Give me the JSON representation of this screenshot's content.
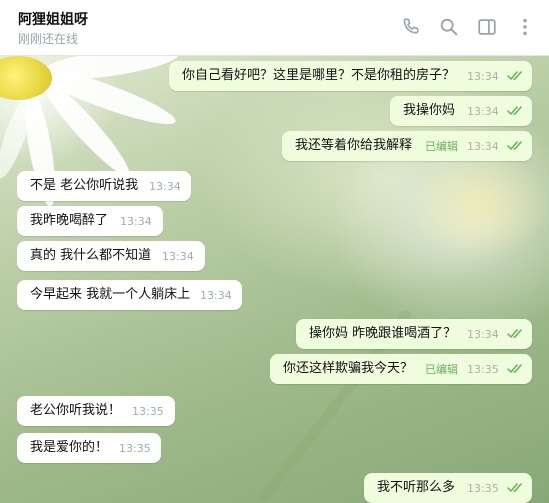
{
  "header": {
    "title": "阿狸姐姐呀",
    "status": "刚刚还在线",
    "icons": [
      "phone-icon",
      "search-icon",
      "sidebar-icon",
      "more-icon"
    ]
  },
  "theme": {
    "outgoing_bubble": "#effdde",
    "incoming_bubble": "#ffffff",
    "check_color": "#5fb650",
    "time_color": "#a0acb6"
  },
  "messages": [
    {
      "dir": "out",
      "text": "你自己看好吧？这里是哪里？不是你租的房子？",
      "time": "13:34",
      "read": true
    },
    {
      "dir": "out",
      "text": "我操你妈",
      "time": "13:34",
      "read": true
    },
    {
      "dir": "out",
      "text": "我还等着你给我解释",
      "edited": "已编辑",
      "time": "13:34",
      "read": true
    },
    {
      "dir": "in",
      "text": "不是 老公你听说我",
      "time": "13:34"
    },
    {
      "dir": "in",
      "text": "我昨晚喝醉了",
      "time": "13:34"
    },
    {
      "dir": "in",
      "text": "真的 我什么都不知道",
      "time": "13:34"
    },
    {
      "dir": "in",
      "text": "今早起来 我就一个人躺床上",
      "time": "13:34"
    },
    {
      "dir": "out",
      "text": "操你妈 昨晚跟谁喝酒了？",
      "time": "13:34",
      "read": true
    },
    {
      "dir": "out",
      "text": "你还这样欺骗我今天？",
      "edited": "已编辑",
      "time": "13:35",
      "read": true
    },
    {
      "dir": "in",
      "text": "老公你听我说！",
      "time": "13:35"
    },
    {
      "dir": "in",
      "text": "我是爱你的！",
      "time": "13:35"
    },
    {
      "dir": "out",
      "text": "我不听那么多",
      "time": "13:35",
      "read": true
    }
  ]
}
